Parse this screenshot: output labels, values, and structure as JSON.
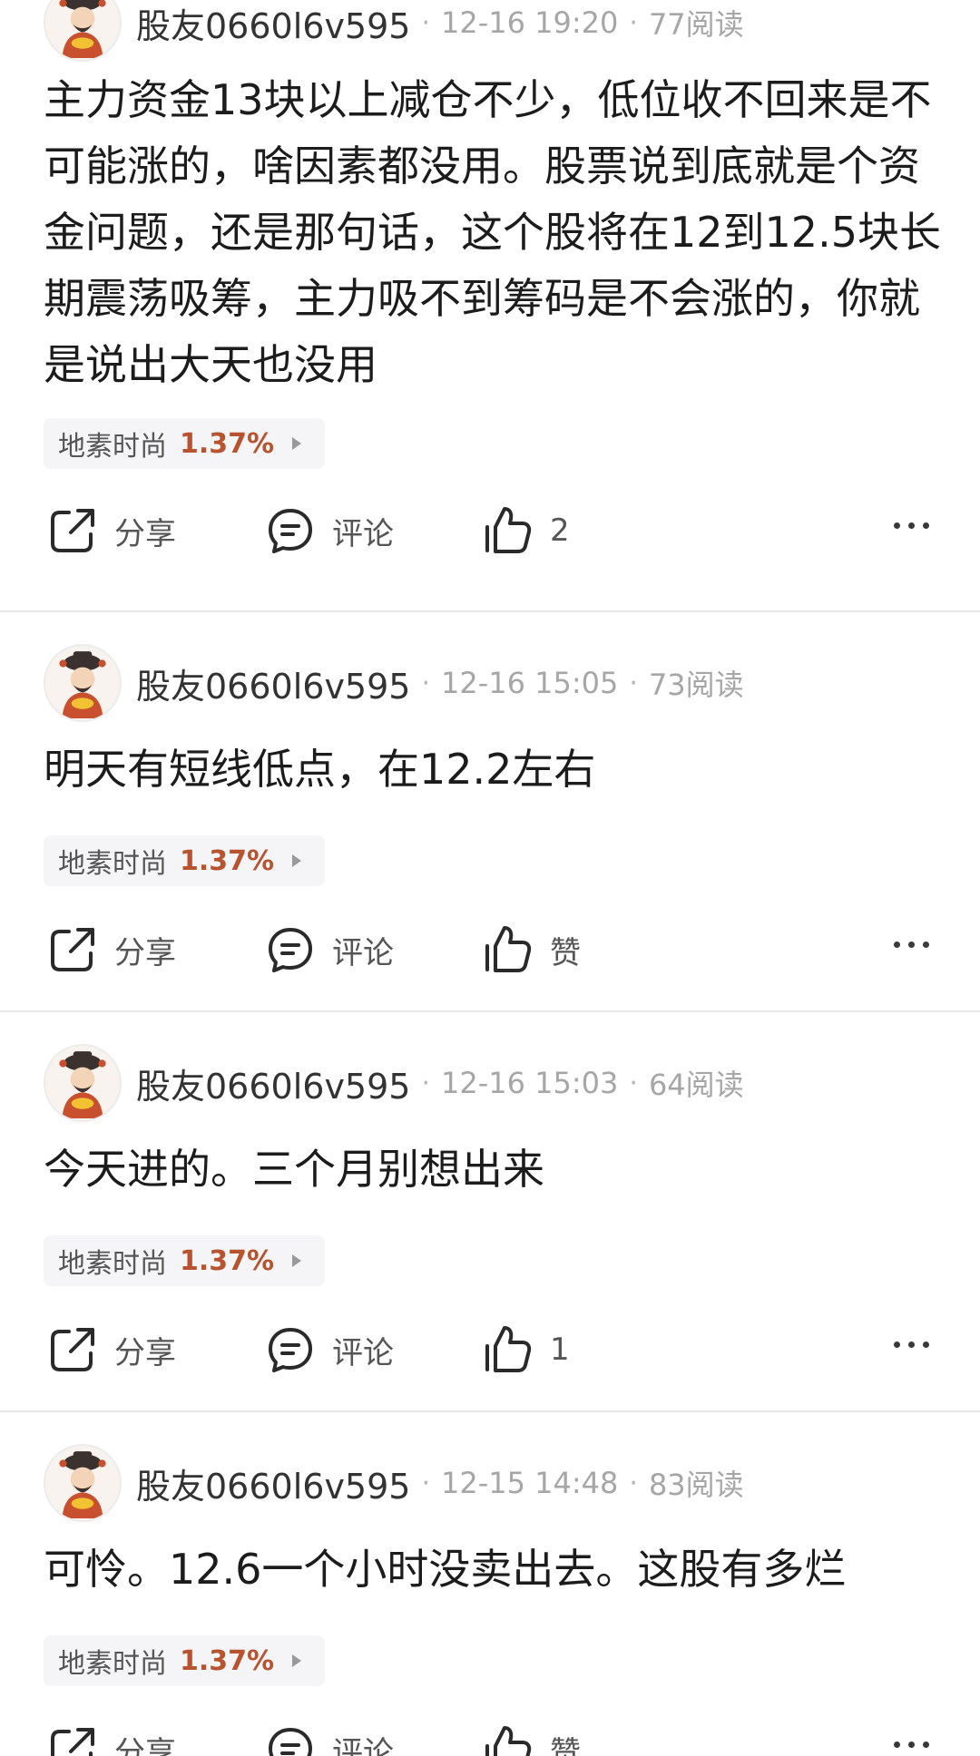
{
  "posts": [
    {
      "username": "股友0660l6v595",
      "time": "12-16 19:20",
      "reads": "77阅读",
      "text": "主力资金13块以上减仓不少，低位收不回来是不可能涨的，啥因素都没用。股票说到底就是个资金问题，还是那句话，这个股将在12到12.5块长期震荡吸筹，主力吸不到筹码是不会涨的，你就是说出大天也没用",
      "stock": {
        "name": "地素时尚",
        "change": "1.37%"
      },
      "share_label": "分享",
      "comment_label": "评论",
      "like_label": "2"
    },
    {
      "username": "股友0660l6v595",
      "time": "12-16 15:05",
      "reads": "73阅读",
      "text": "明天有短线低点，在12.2左右",
      "stock": {
        "name": "地素时尚",
        "change": "1.37%"
      },
      "share_label": "分享",
      "comment_label": "评论",
      "like_label": "赞"
    },
    {
      "username": "股友0660l6v595",
      "time": "12-16 15:03",
      "reads": "64阅读",
      "text": "今天进的。三个月别想出来",
      "stock": {
        "name": "地素时尚",
        "change": "1.37%"
      },
      "share_label": "分享",
      "comment_label": "评论",
      "like_label": "1"
    },
    {
      "username": "股友0660l6v595",
      "time": "12-15 14:48",
      "reads": "83阅读",
      "text": "可怜。12.6一个小时没卖出去。这股有多烂",
      "stock": {
        "name": "地素时尚",
        "change": "1.37%"
      },
      "share_label": "分享",
      "comment_label": "评论",
      "like_label": "赞"
    }
  ],
  "separator": "·",
  "icons": {
    "avatar": "god-of-wealth-avatar",
    "share": "share-icon",
    "comment": "comment-icon",
    "like": "thumbs-up-icon",
    "more": "more-icon"
  },
  "colors": {
    "stock_change": "#b8532f",
    "tag_background": "#f5f5f7",
    "divider": "#e6e6e6"
  }
}
